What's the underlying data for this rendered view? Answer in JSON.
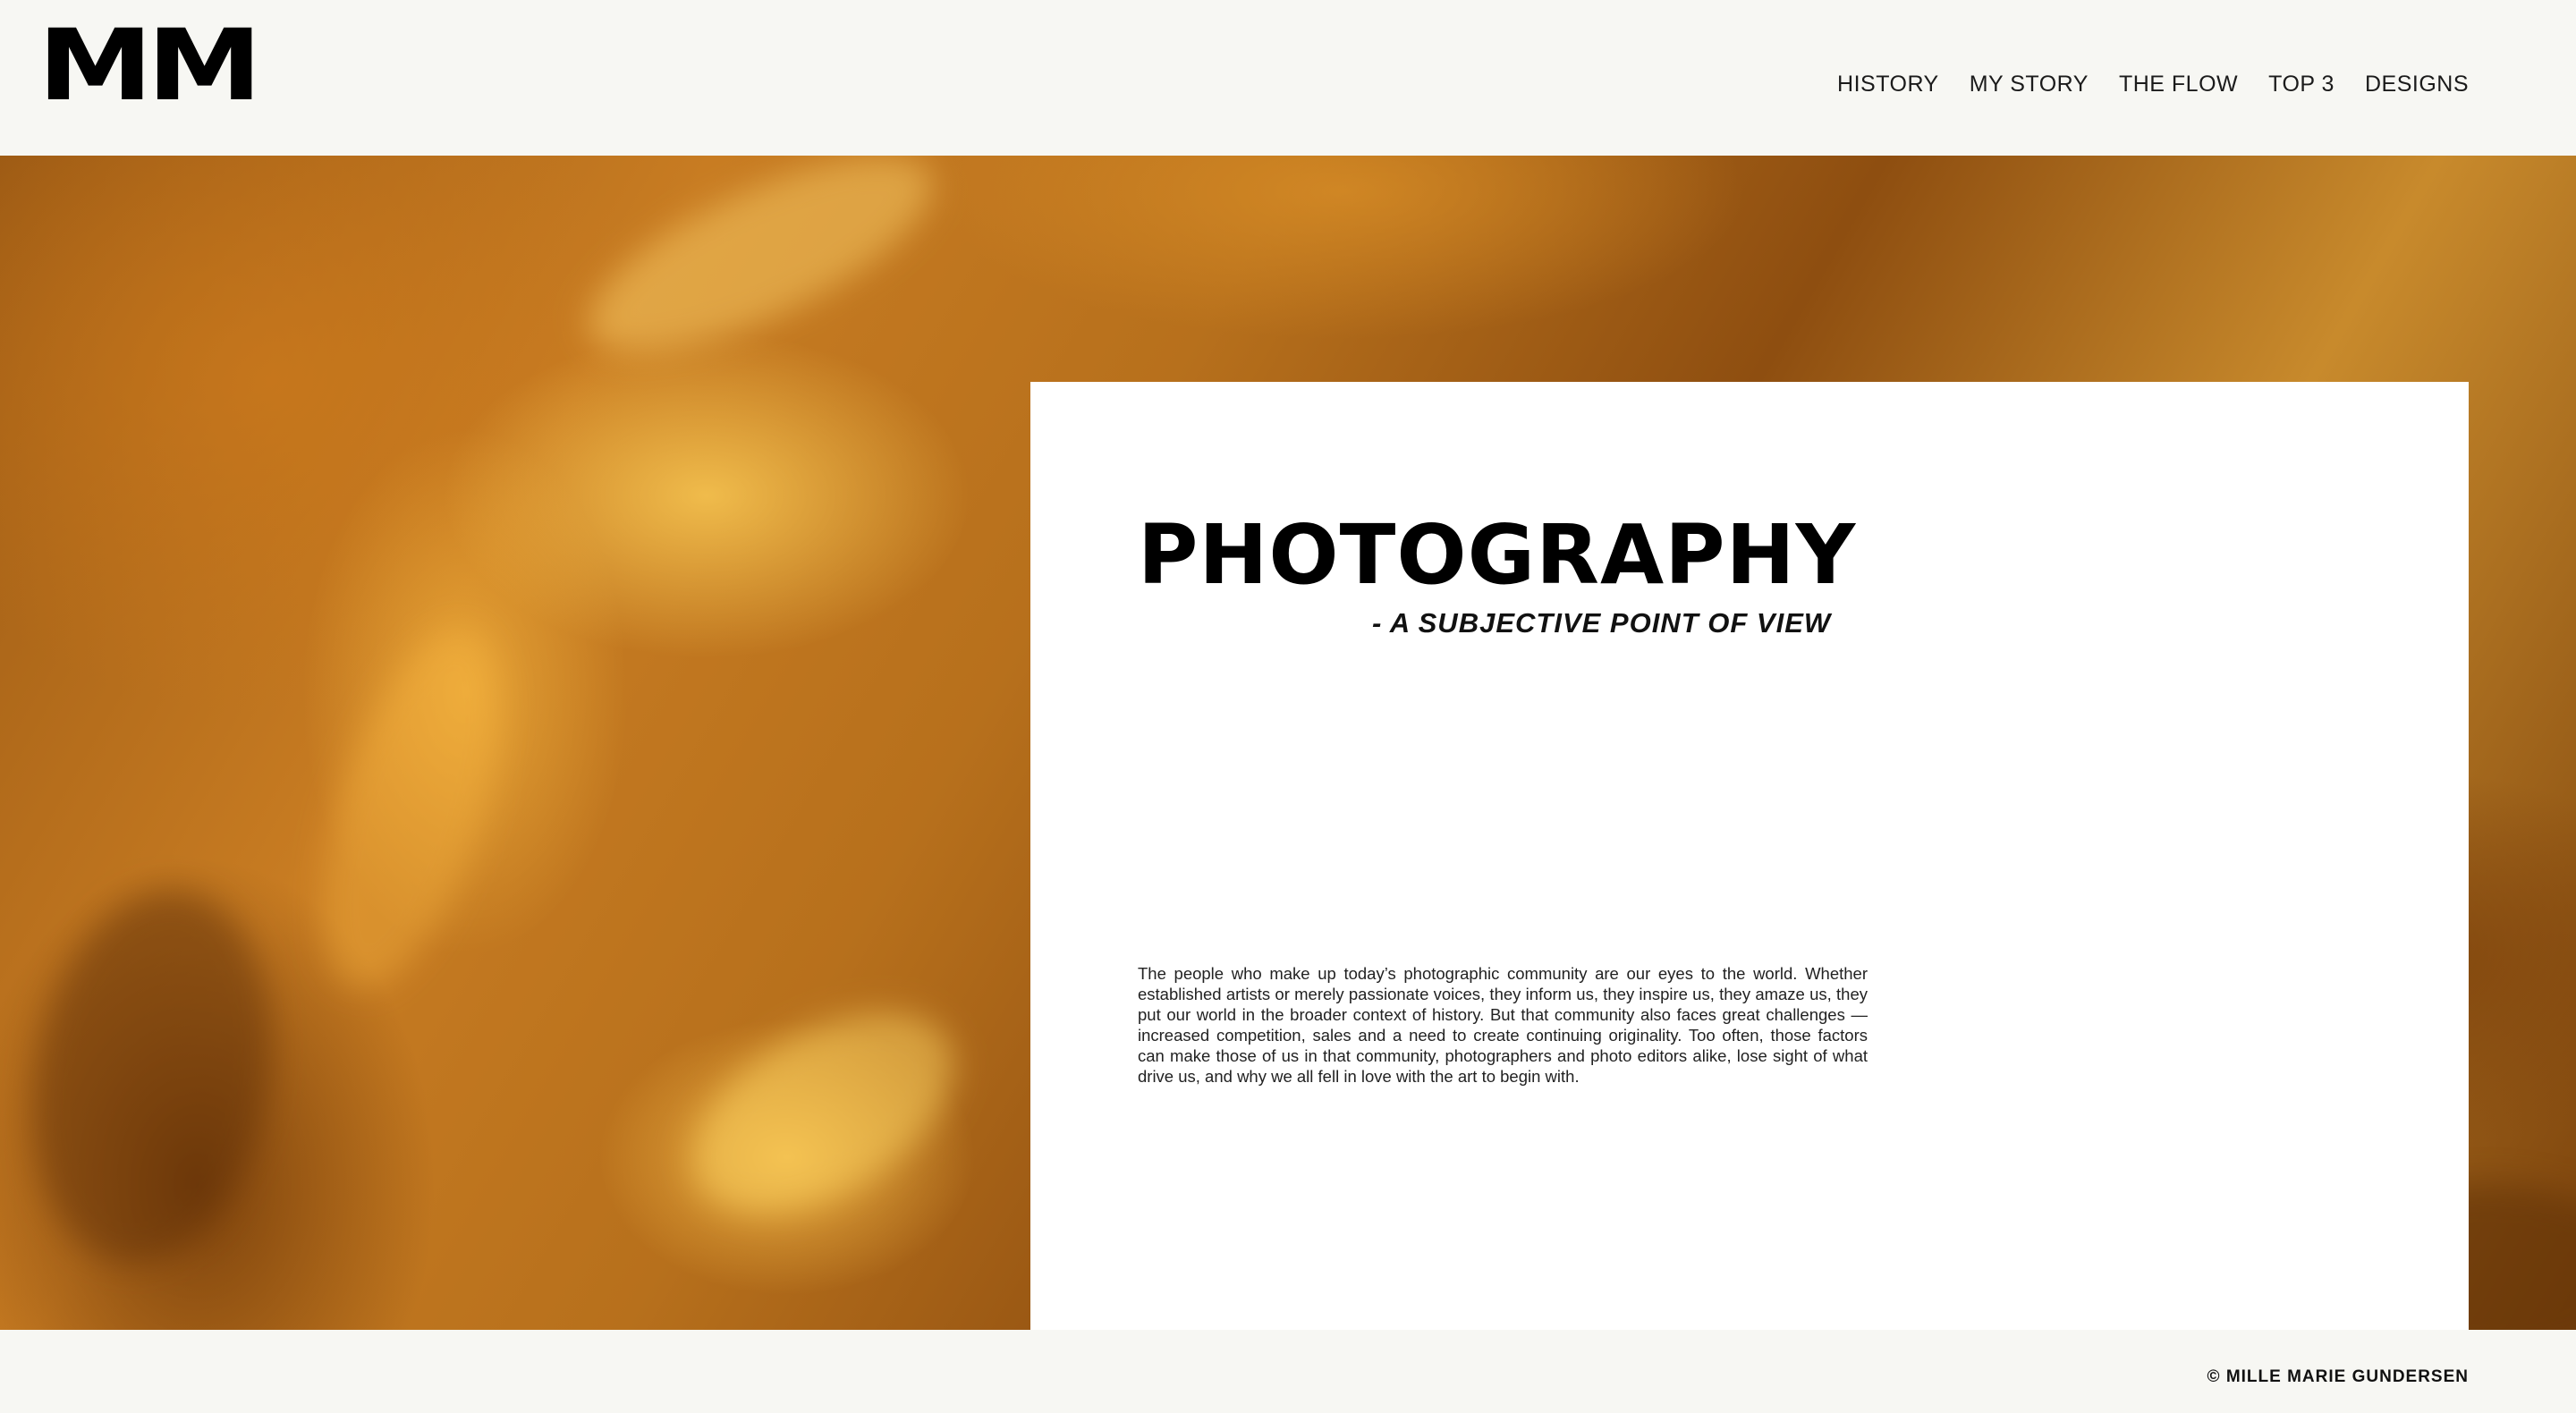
{
  "header": {
    "logo": "MM",
    "nav": [
      {
        "label": "HISTORY"
      },
      {
        "label": "MY STORY"
      },
      {
        "label": "THE FLOW"
      },
      {
        "label": "TOP 3"
      },
      {
        "label": "DESIGNS"
      }
    ]
  },
  "hero": {
    "background_colors": [
      "#9c5a14",
      "#c87c22",
      "#ffd25a",
      "#7b420c"
    ]
  },
  "card": {
    "title": "PHOTOGRAPHY",
    "subtitle": "- A SUBJECTIVE POINT OF VIEW",
    "body": "The people who make up today’s photographic community are our eyes to the world. Whether established artists or merely passionate voices, they inform us, they inspire us, they amaze us, they put our world in the broader context of history. But that community also faces great challenges —increased competition, sales and a need to create continuing originality. Too often, those factors can make those of us in that community, photographers and photo editors alike, lose sight of what drive us, and why we all fell in love with the art to begin with."
  },
  "footer": {
    "copyright": "© MILLE MARIE GUNDERSEN"
  }
}
